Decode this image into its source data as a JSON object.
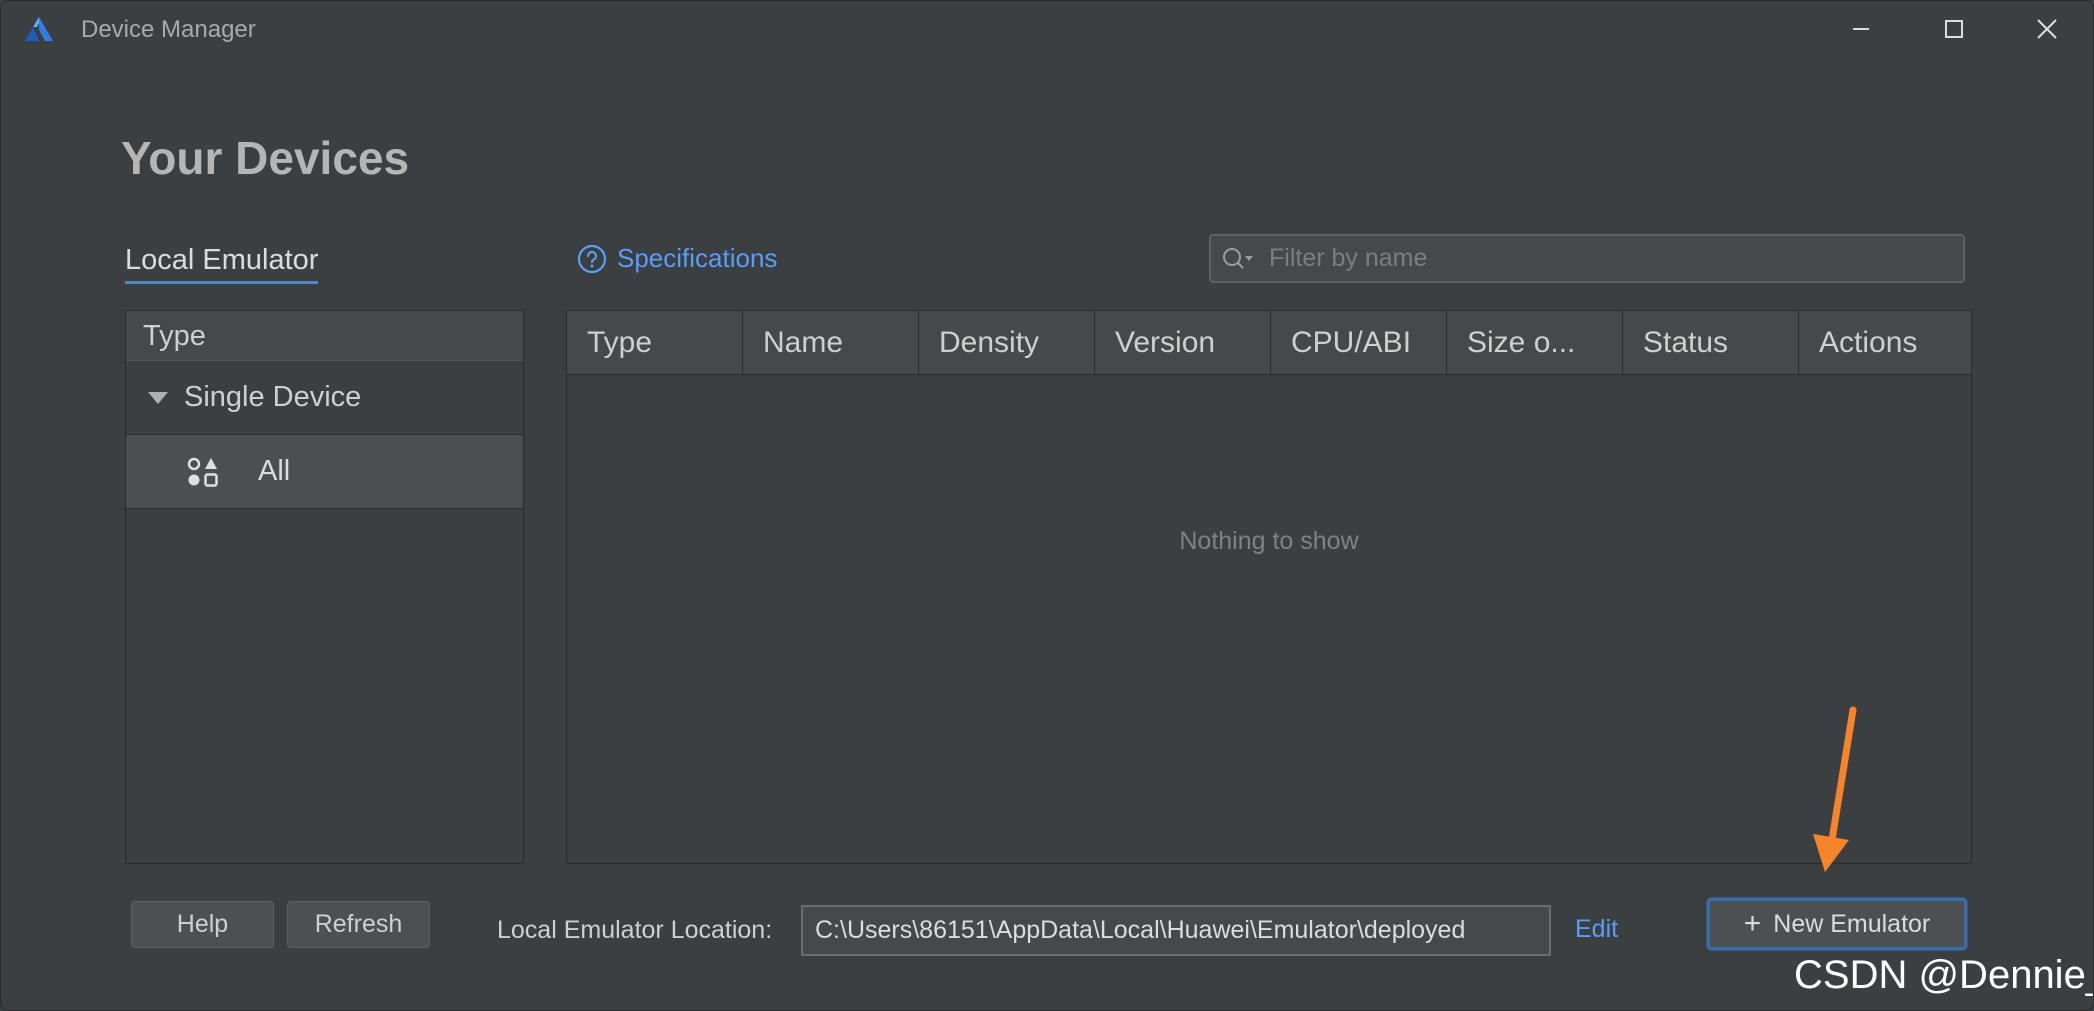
{
  "window": {
    "title": "Device Manager"
  },
  "page": {
    "title": "Your Devices"
  },
  "tabs": {
    "local_emulator": "Local Emulator"
  },
  "specifications": {
    "label": "Specifications"
  },
  "filter": {
    "placeholder": "Filter by name",
    "value": ""
  },
  "type_panel": {
    "header": "Type",
    "group_label": "Single Device",
    "item_label": "All"
  },
  "table": {
    "columns": [
      "Type",
      "Name",
      "Density",
      "Version",
      "CPU/ABI",
      "Size o...",
      "Status",
      "Actions"
    ],
    "empty_text": "Nothing to show"
  },
  "bottom": {
    "help_label": "Help",
    "refresh_label": "Refresh",
    "location_label": "Local Emulator Location:",
    "location_value": "C:\\Users\\86151\\AppData\\Local\\Huawei\\Emulator\\deployed",
    "edit_label": "Edit",
    "new_emulator_label": "New Emulator"
  },
  "watermark": {
    "text": "CSDN @Dennie_"
  },
  "colors": {
    "background": "#3c3f41",
    "link": "#589df6",
    "accent_arrow": "#f5842b",
    "tab_underline": "#4a88c7"
  }
}
